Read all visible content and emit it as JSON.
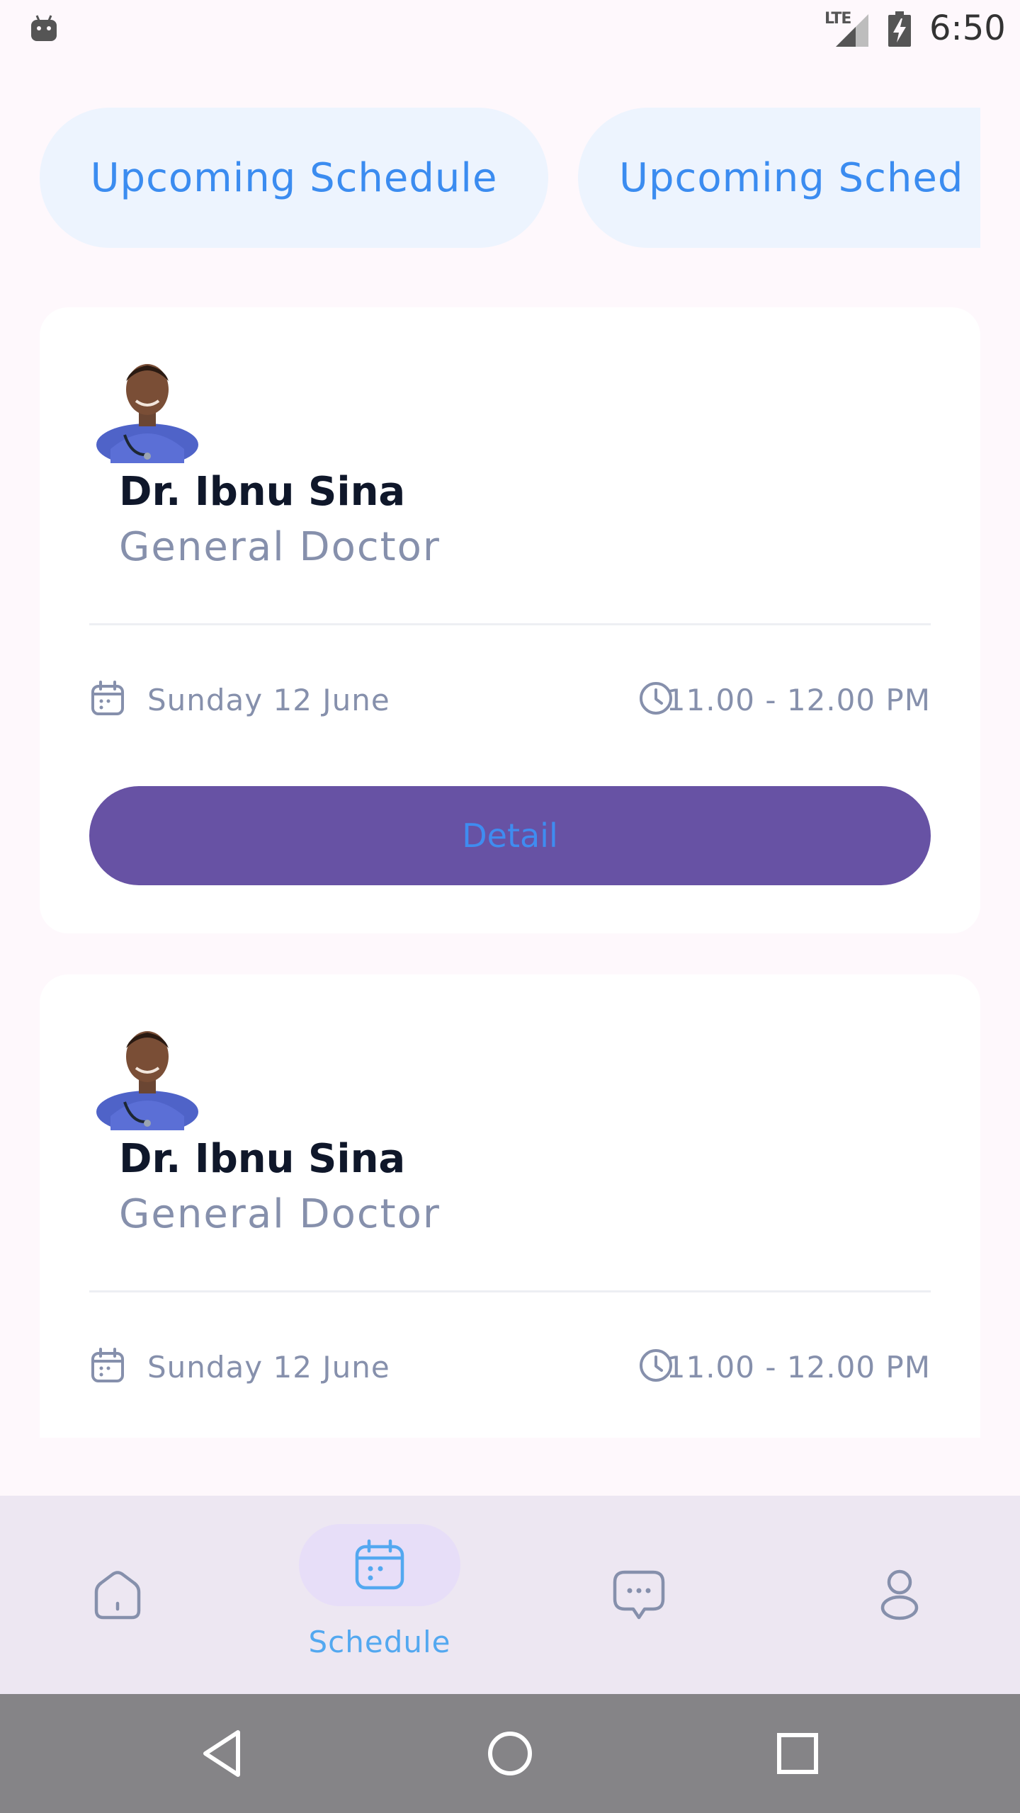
{
  "status_bar": {
    "network": "LTE",
    "time": "6:50"
  },
  "tabs": [
    {
      "label": "Upcoming Schedule"
    },
    {
      "label": "Upcoming Sched"
    }
  ],
  "appointments": [
    {
      "doctor_name": "Dr. Ibnu Sina",
      "doctor_role": "General Doctor",
      "date": "Sunday 12 June",
      "time": "11.00 - 12.00 PM",
      "button_label": "Detail"
    },
    {
      "doctor_name": "Dr. Ibnu Sina",
      "doctor_role": "General Doctor",
      "date": "Sunday 12 June",
      "time": "11.00 - 12.00 PM"
    }
  ],
  "bottom_nav": {
    "items": [
      {
        "icon": "home-icon"
      },
      {
        "icon": "calendar-icon",
        "label": "Schedule",
        "active": true
      },
      {
        "icon": "chat-icon"
      },
      {
        "icon": "profile-icon"
      }
    ]
  },
  "colors": {
    "accent_blue": "#3B8CF0",
    "detail_button": "#6752A4",
    "muted_text": "#8690AC"
  }
}
